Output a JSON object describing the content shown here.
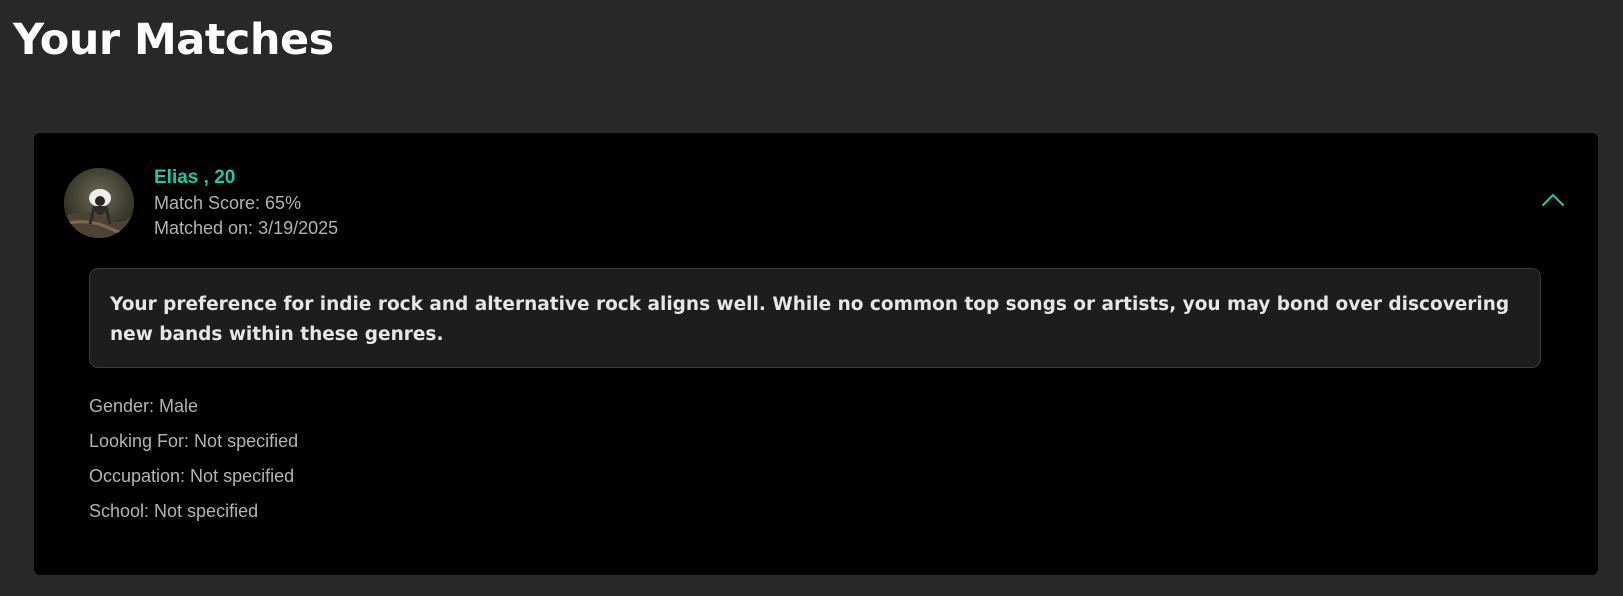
{
  "page": {
    "title": "Your Matches"
  },
  "match": {
    "name_age": "Elias , 20",
    "score_text": "Match Score: 65%",
    "matched_on_text": "Matched on: 3/19/2025",
    "compatibility": "Your preference for indie rock and alternative rock aligns well. While no common top songs or artists, you may bond over discovering new bands within these genres.",
    "details": [
      "Gender: Male",
      "Looking For: Not specified",
      "Occupation: Not specified",
      "School: Not specified"
    ],
    "expanded": true,
    "toggle_icon": "chevron-up-icon",
    "avatar_icon": "profile-photo"
  },
  "colors": {
    "accent": "#1fc7a5",
    "page_bg": "#282828",
    "card_bg": "#000000",
    "panel_bg": "#1d1d1d",
    "muted_text": "#b3b3b3"
  }
}
